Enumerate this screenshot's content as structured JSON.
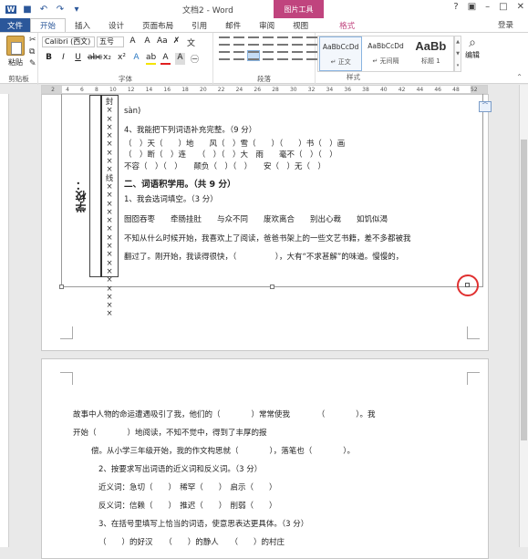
{
  "app": {
    "title": "文档2 - Word",
    "context_tab_group": "图片工具",
    "login": "登录"
  },
  "tabs": [
    {
      "label": "文件"
    },
    {
      "label": "开始"
    },
    {
      "label": "插入"
    },
    {
      "label": "设计"
    },
    {
      "label": "页面布局"
    },
    {
      "label": "引用"
    },
    {
      "label": "邮件"
    },
    {
      "label": "审阅"
    },
    {
      "label": "视图"
    },
    {
      "label": "格式"
    }
  ],
  "ribbon": {
    "paste_label": "粘贴",
    "clipboard_label": "剪贴板",
    "font_name": "Calibri (西文)",
    "font_size": "五号",
    "font_group_label": "字体",
    "paragraph_group_label": "段落",
    "styles_group_label": "样式",
    "editing_label": "编辑",
    "styles": [
      {
        "preview": "AaBbCcDd",
        "name": "↵ 正文"
      },
      {
        "preview": "AaBbCcDd",
        "name": "↵ 无间隔"
      },
      {
        "preview": "AaBb",
        "name": "标题 1"
      }
    ]
  },
  "ruler_ticks": [
    "2",
    "4",
    "6",
    "8",
    "10",
    "12",
    "14",
    "16",
    "18",
    "20",
    "22",
    "24",
    "26",
    "28",
    "30",
    "32",
    "34",
    "36",
    "38",
    "40",
    "42",
    "44",
    "46",
    "48",
    "52"
  ],
  "page1": {
    "line_pinyin": "sàn)",
    "q4_title": "4、我能把下列词语补充完整。（9 分）",
    "q4_row1": "（　）天（　　）地　　风（　）雪（　　）（　　）书（　）画",
    "q4_row2": "（　）断（　）连　　（　）（　）大　雨　　毫不（　）（　）",
    "q4_row3": "不容（　）（　）　　颠负（　）（　）　　安（　）无（　）",
    "section2": "二、词语积学用。（共 9 分）",
    "q1_title": "1、我会选词填空。（3 分）",
    "idioms": "囫囵吞枣　　牵肠挂肚　　与众不同　　废欢离合　　别出心裁　　如饥似渴",
    "passage1": "不知从什么时候开始，我喜欢上了阅读，爸爸书架上的一些文艺书籍，差不多都被我",
    "passage2": "翻过了。刚开始，我读得很快，（　　　　　），大有“不求甚解”的味道。慢慢的，",
    "seal_text": "封××××××××线××××××××××××××××",
    "school_label": "学校："
  },
  "page2": {
    "line1": "故事中人物的命运遭遇吸引了我，他们的（　　　　）常常使我　　　　（　　　　）。我",
    "line2": "开始（　　　　）地阅读，不知不觉中，得到了丰厚的报",
    "line3": "偿。从小学三年级开始，我的作文构思就（　　　　），落笔也（　　　　）。",
    "q2_title": "2、按要求写出词语的近义词和反义词。（3 分）",
    "synonyms": "近义词：急切（　　）　稀罕（　　）　启示（　　）",
    "antonyms": "反义词：信赖（　　）　推迟（　　）　削弱（　　）",
    "q3_title": "3、在括号里填写上恰当的词语，使意思表达更具体。（3 分）",
    "q3_row": "（　　）的好汉　　（　　）的静人　　（　　）的村庄"
  }
}
